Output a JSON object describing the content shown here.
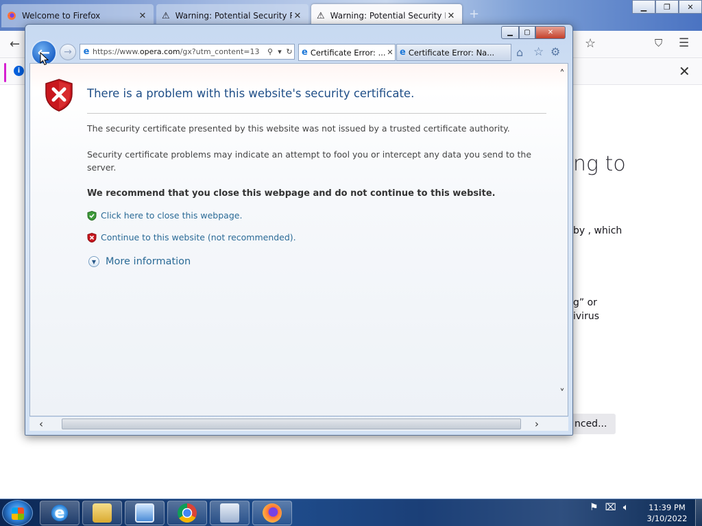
{
  "firefox": {
    "tabs": [
      {
        "label": "Welcome to Firefox"
      },
      {
        "label": "Warning: Potential Security Risk"
      },
      {
        "label": "Warning: Potential Security Risk"
      }
    ],
    "new_tab": "+",
    "back_glyph": "←",
    "page_fragments": {
      "heading": "ng to",
      "line1": "by , which",
      "line2": "g” or",
      "line3": "ivirus",
      "advanced_button": "nced..."
    }
  },
  "ie": {
    "address_prefix": "https://www.",
    "address_domain": "opera.com",
    "address_rest": "/gx?utm_content=13",
    "tabs": [
      {
        "label": "Certificate Error: ..."
      },
      {
        "label": "Certificate Error: Na..."
      }
    ],
    "page": {
      "title": "There is a problem with this website's security certificate.",
      "para1": "The security certificate presented by this website was not issued by a trusted certificate authority.",
      "para2": "Security certificate problems may indicate an attempt to fool you or intercept any data you send to the server.",
      "recommendation": "We recommend that you close this webpage and do not continue to this website.",
      "close_link": "Click here to close this webpage.",
      "continue_link": "Continue to this website (not recommended).",
      "more_info": "More information"
    }
  },
  "taskbar": {
    "time": "11:39 PM",
    "date": "3/10/2022"
  },
  "colors": {
    "ie_title": "#1f4e87",
    "link": "#2a6a96",
    "shield_red": "#c8171e",
    "shield_ok_green": "#3e9b3a"
  }
}
